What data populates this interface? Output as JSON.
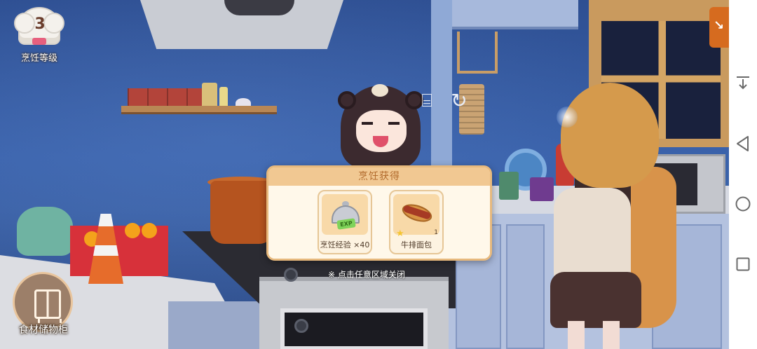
{
  "hud": {
    "cooking_level_value": "3",
    "cooking_level_label": "烹饪等级",
    "storage_label": "食材储物柜"
  },
  "panel": {
    "title": "烹饪获得",
    "rewards": [
      {
        "label": "烹饪经验 ×40",
        "icon": "exp-cloche-icon",
        "exp_tag": "EXP"
      },
      {
        "label": "牛排面包",
        "icon": "steak-bread-icon",
        "count": "1",
        "rarity_icon": "star-icon"
      }
    ],
    "close_hint": "※ 点击任意区域关闭"
  },
  "scene_icons": [
    "blender-icon",
    "refresh-icon"
  ],
  "navbar": {
    "items": [
      "collapse-icon",
      "back-icon",
      "home-icon",
      "recents-icon"
    ]
  },
  "colors": {
    "panel_bg": "#fbf1de",
    "panel_header": "#f1c892",
    "panel_title": "#b26b2d",
    "accent_orange": "#d66b1f"
  }
}
